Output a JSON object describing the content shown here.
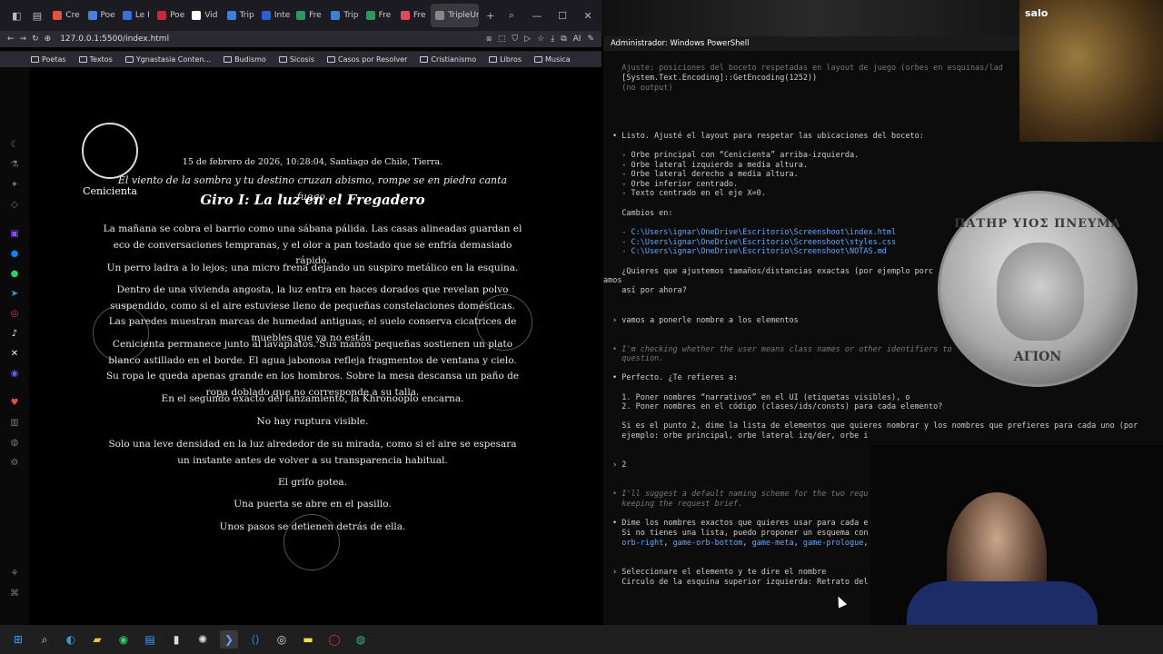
{
  "browser": {
    "tabs": [
      {
        "label": "Cre",
        "color": "#e0543c"
      },
      {
        "label": "Poe",
        "color": "#4a7ee0"
      },
      {
        "label": "Le I",
        "color": "#3a6fd8"
      },
      {
        "label": "Poe",
        "color": "#c8283c"
      },
      {
        "label": "Vid",
        "color": "#ffffff"
      },
      {
        "label": "Trip",
        "color": "#3a7fd8"
      },
      {
        "label": "Inte",
        "color": "#2a5fd8"
      },
      {
        "label": "Fre",
        "color": "#2a9a5a"
      },
      {
        "label": "Trip",
        "color": "#3a7fd8"
      },
      {
        "label": "Fre",
        "color": "#2a9a5a"
      },
      {
        "label": "Fre",
        "color": "#e04a5a"
      },
      {
        "label": "TripleUn",
        "color": "#888888"
      }
    ],
    "url": "127.0.0.1:5500/index.html",
    "ai_label": "AI",
    "bookmarks": [
      "Poetas",
      "Textos",
      "Ygnastasia Conten...",
      "Budismo",
      "Sicosis",
      "Casos por Resolver",
      "Cristianismo",
      "Libros",
      "Musica"
    ]
  },
  "page": {
    "orb_label": "Cenicienta",
    "meta": "15 de febrero de 2026, 10:28:04, Santiago de Chile, Tierra.",
    "epigraph": "El viento de la sombra y tu destino cruzan abismo, rompe se en piedra canta fuego.",
    "chapter": "Giro I: La luz en el Fregadero",
    "p1": "La mañana se cobra el barrio como una sábana pálida. Las casas alineadas guardan el eco de conversaciones tempranas, y el olor a pan tostado que se enfría demasiado rápido.",
    "p2": "Un perro ladra a lo lejos; una micro frena dejando un suspiro metálico en la esquina.",
    "p3": "Dentro de una vivienda angosta, la luz entra en haces dorados que revelan polvo suspendido, como si el aire estuviese lleno de pequeñas constelaciones domésticas. Las paredes muestran marcas de humedad antiguas; el suelo conserva cicatrices de muebles que ya no están.",
    "p4": "Cenicienta permanece junto al lavaplatos. Sus manos pequeñas sostienen un plato blanco astillado en el borde. El agua jabonosa refleja fragmentos de ventana y cielo. Su ropa le queda apenas grande en los hombros. Sobre la mesa descansa un paño de ropa doblado que no corresponde a su talla.",
    "p5": "En el segundo exacto del lanzamiento, la Khronooplo encarna.",
    "p6": "No hay ruptura visible.",
    "p7": "Solo una leve densidad en la luz alrededor de su mirada, como si el aire se espesara un instante antes de volver a su transparencia habitual.",
    "p8": "El grifo gotea.",
    "p9": "Una puerta se abre en el pasillo.",
    "p10": "Unos pasos se detienen detrás de ella."
  },
  "terminal": {
    "title": "Administrador: Windows PowerShell",
    "l1": "  Ajuste: posiciones del boceto respetadas en layout de juego (orbes en esquinas/lad",
    "l2": "  [System.Text.Encoding]::GetEncoding(1252))",
    "l3": "  (no output)",
    "l4": "• Listo. Ajusté el layout para respetar las ubicaciones del boceto:",
    "l5": "  - Orbe principal con “Cenicienta” arriba-izquierda.",
    "l6": "  - Orbe lateral izquierdo a media altura.",
    "l7": "  - Orbe lateral derecho a media altura.",
    "l8": "  - Orbe inferior centrado.",
    "l9": "  - Texto centrado en el eje X=0.",
    "l10": "  Cambios en:",
    "l11": "  - C:\\Users\\ignar\\OneDrive\\Escritorio\\Screenshoot\\index.html",
    "l12": "  - C:\\Users\\ignar\\OneDrive\\Escritorio\\Screenshoot\\styles.css",
    "l13": "  - C:\\Users\\ignar\\OneDrive\\Escritorio\\Screenshoot\\NOTAS.md",
    "l14": "  ¿Quieres que ajustemos tamaños/distancias exactas (por ejemplo porc",
    "l15": "amos",
    "l16": "  así por ahora?",
    "l17": "› vamos a ponerle nombre a los elementos",
    "l18": "• I'm checking whether the user means class names or other identifiers to",
    "l19": "  question.",
    "l20": "• Perfecto. ¿Te refieres a:",
    "l21": "  1. Poner nombres “narrativos” en el UI (etiquetas visibles), o",
    "l22": "  2. Poner nombres en el código (clases/ids/consts) para cada elemento?",
    "l23": "  Si es el punto 2, dime la lista de elementos que quieres nombrar y los nombres que prefieres para cada uno (por",
    "l24": "  ejemplo: orbe principal, orbe lateral izq/der, orbe i",
    "l25": "› 2",
    "l26": "• I'll suggest a default naming scheme for the two requ",
    "l27": "  keeping the request brief.",
    "l28": "• Dime los nombres exactos que quieres usar para cada e",
    "l29": "  Si no tienes una lista, puedo proponer un esquema con",
    "l30a": "  orb-right",
    "l30b": "game-orb-bottom",
    "l30c": "game-meta",
    "l30d": "game-prologue",
    "l31": "› Seleccionare el elemento y te dire el nombre",
    "l32": "  Circulo de la esquina superior izquierda: Retrato del"
  },
  "overlays": {
    "webcam_label": "salo",
    "coin_top": "ΠΑΤΗΡ ΥΙΟΣ ΠΝΕΥΜΑ",
    "coin_bottom": "ΑΓΙΟΝ"
  }
}
